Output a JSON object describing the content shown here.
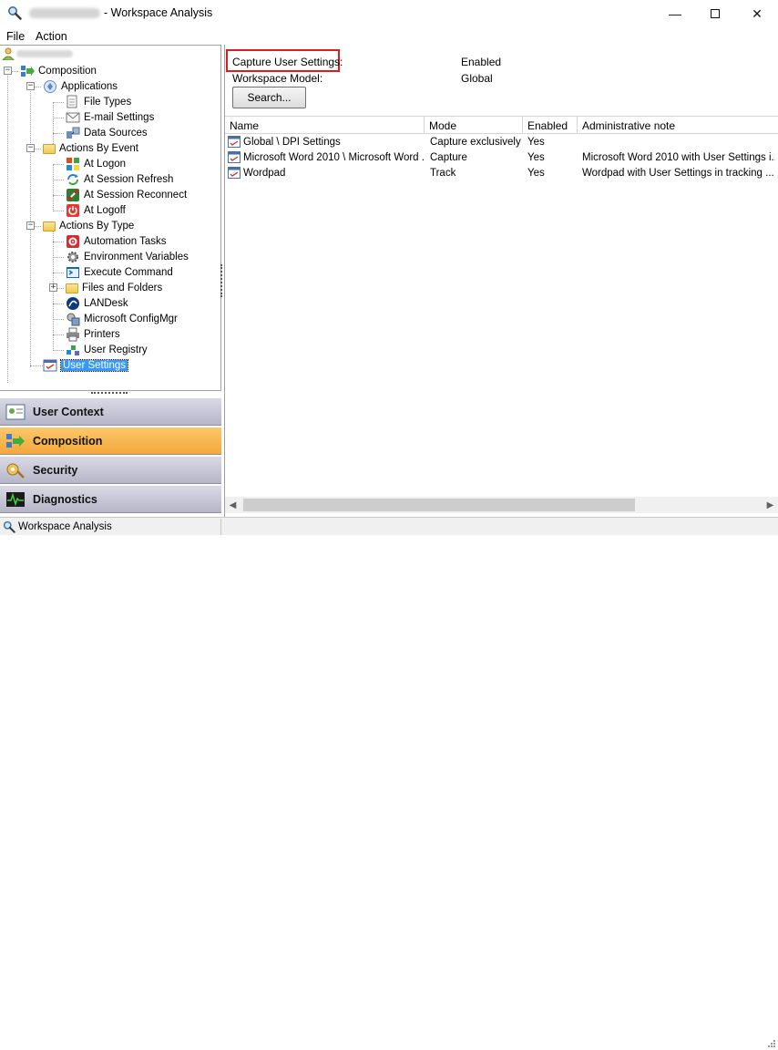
{
  "window": {
    "title": "- Workspace Analysis",
    "min_label": "—",
    "close_label": "✕"
  },
  "menu": [
    "File",
    "Action"
  ],
  "tree": {
    "root": "Composition",
    "items": [
      {
        "label": "Applications",
        "icon": "applications-icon"
      },
      {
        "label": "File Types",
        "icon": "file-types-icon"
      },
      {
        "label": "E-mail Settings",
        "icon": "email-settings-icon"
      },
      {
        "label": "Data Sources",
        "icon": "data-sources-icon"
      },
      {
        "label": "Actions By Event",
        "icon": "folder-icon"
      },
      {
        "label": "At Logon",
        "icon": "logon-icon"
      },
      {
        "label": "At Session Refresh",
        "icon": "refresh-icon"
      },
      {
        "label": "At Session Reconnect",
        "icon": "reconnect-icon"
      },
      {
        "label": "At Logoff",
        "icon": "logoff-icon"
      },
      {
        "label": "Actions By Type",
        "icon": "folder-icon"
      },
      {
        "label": "Automation Tasks",
        "icon": "automation-icon"
      },
      {
        "label": "Environment Variables",
        "icon": "gear-icon"
      },
      {
        "label": "Execute Command",
        "icon": "execute-icon"
      },
      {
        "label": "Files and Folders",
        "icon": "folder-icon"
      },
      {
        "label": "LANDesk",
        "icon": "landesk-icon"
      },
      {
        "label": "Microsoft ConfigMgr",
        "icon": "configmgr-icon"
      },
      {
        "label": "Printers",
        "icon": "printer-icon"
      },
      {
        "label": "User Registry",
        "icon": "registry-icon"
      },
      {
        "label": "User Settings",
        "icon": "user-settings-icon"
      }
    ]
  },
  "navigator": [
    {
      "label": "User Context",
      "icon": "user-context-icon",
      "active": false
    },
    {
      "label": "Composition",
      "icon": "composition-icon",
      "active": true
    },
    {
      "label": "Security",
      "icon": "security-icon",
      "active": false
    },
    {
      "label": "Diagnostics",
      "icon": "diagnostics-icon",
      "active": false
    }
  ],
  "properties": {
    "capture_label": "Capture User Settings:",
    "capture_value": "Enabled",
    "model_label": "Workspace Model:",
    "model_value": "Global",
    "search_button": "Search..."
  },
  "list": {
    "columns": [
      "Name",
      "Mode",
      "Enabled",
      "Administrative note"
    ],
    "rows": [
      {
        "name": "Global \\ DPI Settings",
        "mode": "Capture exclusively",
        "enabled": "Yes",
        "note": ""
      },
      {
        "name": "Microsoft Word 2010 \\ Microsoft Word ...",
        "mode": "Capture",
        "enabled": "Yes",
        "note": "Microsoft Word 2010 with User Settings i..."
      },
      {
        "name": "Wordpad",
        "mode": "Track",
        "enabled": "Yes",
        "note": "Wordpad with User Settings in tracking ..."
      }
    ]
  },
  "status": {
    "text": "Workspace Analysis"
  },
  "colors": {
    "accent_active": "#f3a73a",
    "selection": "#3399ff",
    "highlight_box": "#e01b1b"
  }
}
